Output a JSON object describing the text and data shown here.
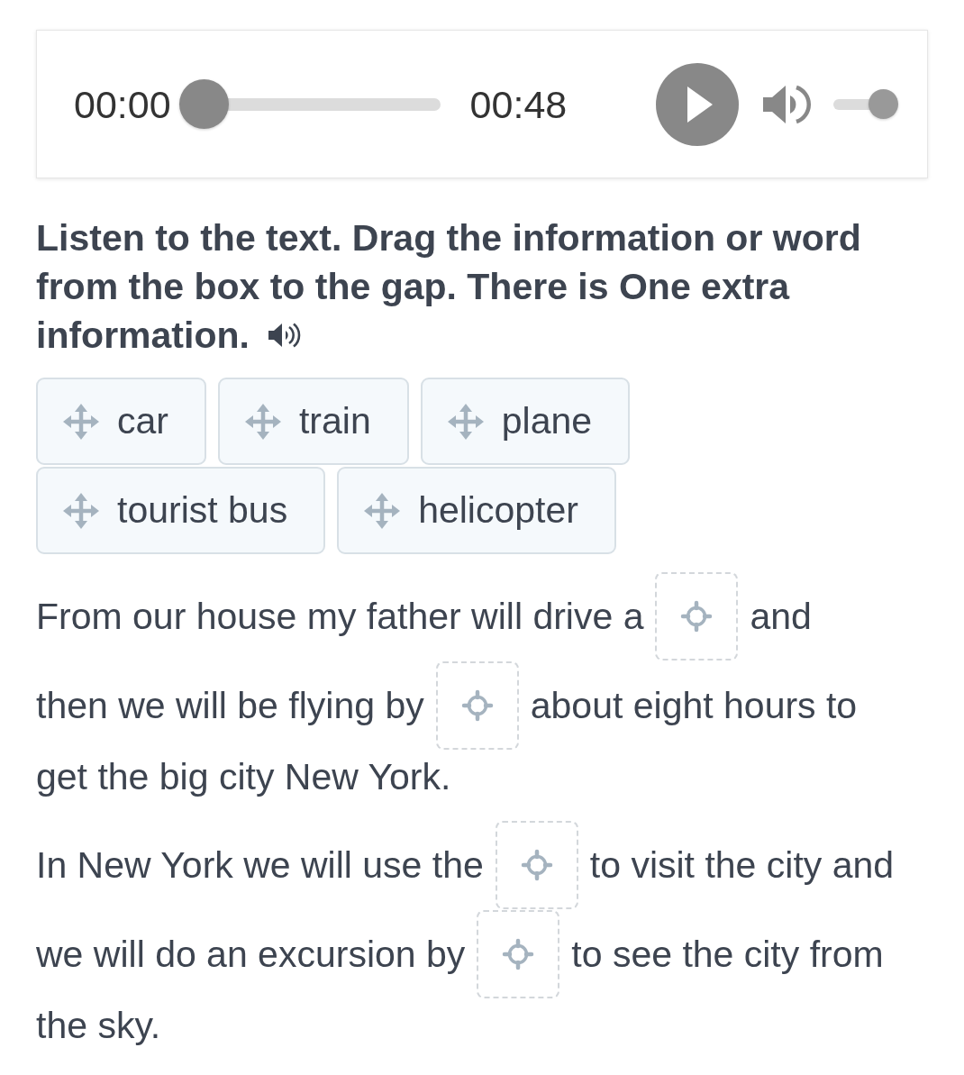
{
  "player": {
    "current_time": "00:00",
    "progress": {
      "level": 0
    },
    "duration": "00:48",
    "playing": false,
    "muted": false,
    "volume": {
      "level": 1
    }
  },
  "instruction": {
    "lines": [
      "Listen to the text. Drag the information or word",
      "from the box to the gap. There is One extra",
      "information."
    ]
  },
  "word_bank": [
    {
      "label": "car"
    },
    {
      "label": "train"
    },
    {
      "label": "plane"
    },
    {
      "label": "tourist bus"
    },
    {
      "label": "helicopter"
    }
  ],
  "paragraphs": [
    {
      "lines": [
        {
          "segments": [
            {
              "kind": "text",
              "text": "From our house my father will drive a"
            },
            {
              "kind": "gap"
            },
            {
              "kind": "text",
              "text": "and"
            }
          ]
        },
        {
          "segments": [
            {
              "kind": "text",
              "text": "then we will be flying by"
            },
            {
              "kind": "gap"
            },
            {
              "kind": "text",
              "text": "about eight hours to"
            }
          ]
        },
        {
          "segments": [
            {
              "kind": "text",
              "text": "get the big city New York."
            }
          ]
        }
      ]
    },
    {
      "lines": [
        {
          "segments": [
            {
              "kind": "text",
              "text": "In New York we will use the"
            },
            {
              "kind": "gap"
            },
            {
              "kind": "text",
              "text": "to visit the city and"
            }
          ]
        },
        {
          "segments": [
            {
              "kind": "text",
              "text": "we will do an excursion by"
            },
            {
              "kind": "gap"
            },
            {
              "kind": "text",
              "text": "to see the city from"
            }
          ]
        },
        {
          "segments": [
            {
              "kind": "text",
              "text": "the sky."
            }
          ]
        }
      ]
    }
  ]
}
